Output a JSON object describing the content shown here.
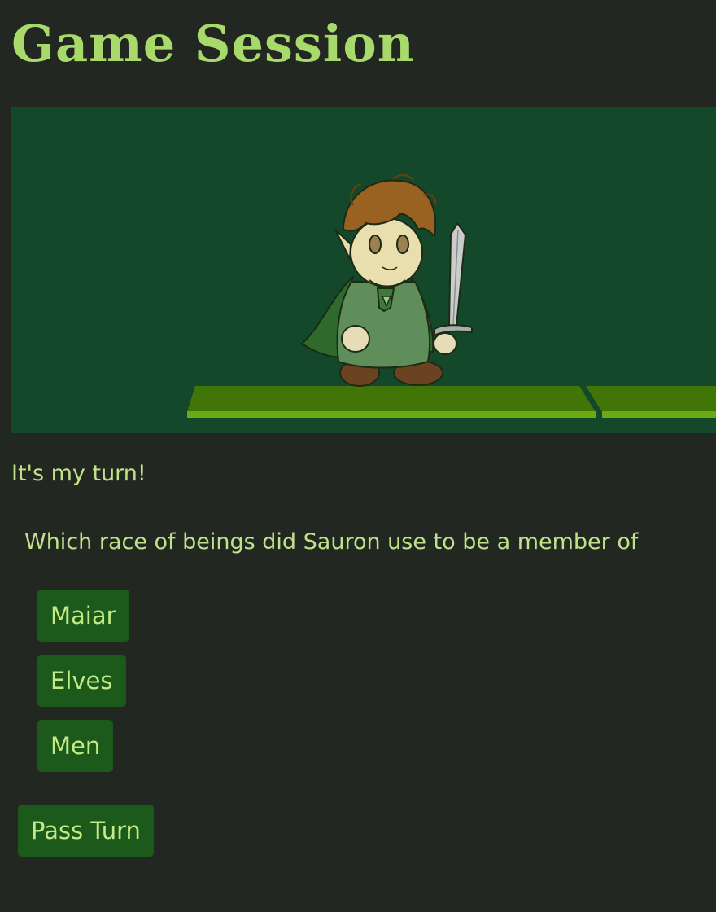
{
  "header": {
    "title": "Game Session"
  },
  "scene": {
    "character": "hobbit-with-sword",
    "colors": {
      "background": "#14482a",
      "platform_top": "#427507",
      "platform_edge": "#6aaa13"
    }
  },
  "status": {
    "turn_text": "It's my turn!"
  },
  "question": {
    "text": "Which race of beings did Sauron use to be a member of",
    "answers": [
      "Maiar",
      "Elves",
      "Men"
    ]
  },
  "actions": {
    "pass_label": "Pass Turn"
  },
  "theme": {
    "page_background": "#222721",
    "accent_text": "#b3db74",
    "button_background": "#1c5a1c"
  }
}
